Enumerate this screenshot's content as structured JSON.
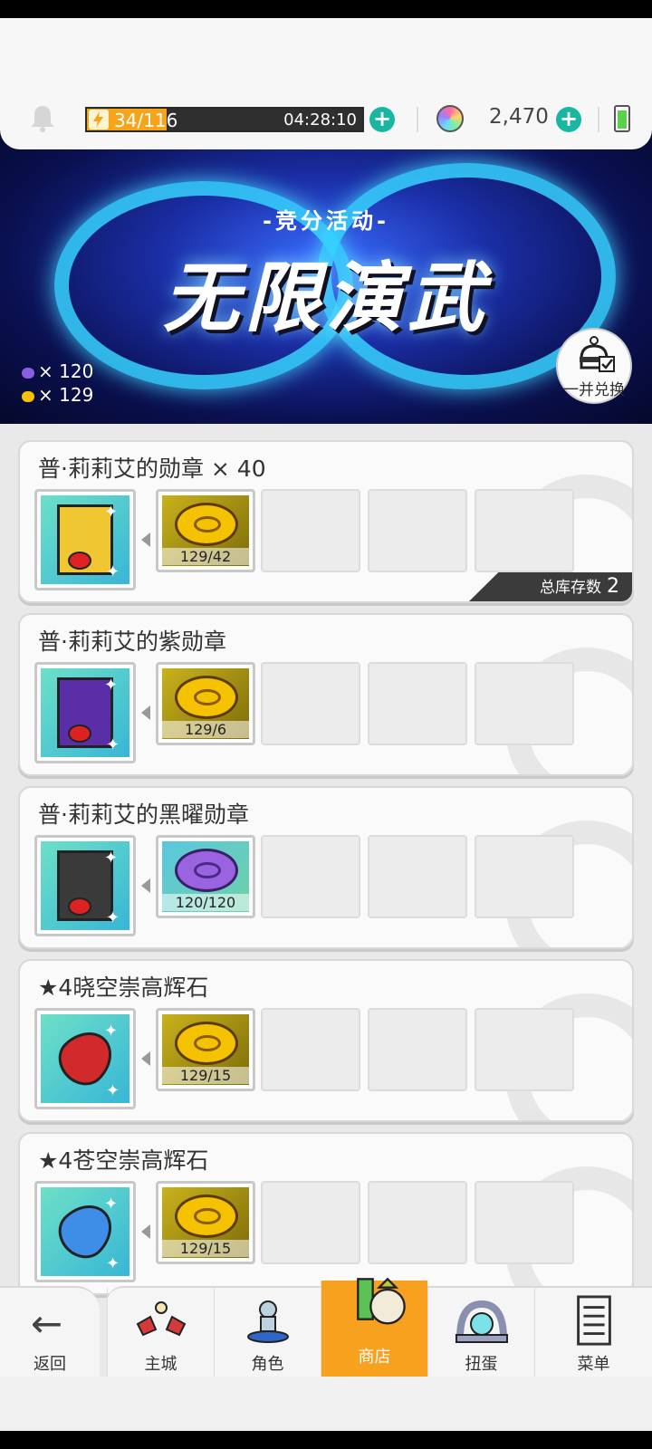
{
  "hud": {
    "stamina_value": "34/116",
    "stamina_fraction": 0.29,
    "stamina_timer": "04:28:10",
    "gem_count": "2,470",
    "accent_color": "#19b7a2"
  },
  "banner": {
    "subtitle": "-竞分活动-",
    "title": "无限演武",
    "tokens": [
      {
        "icon": "purple-token-icon",
        "count": "× 120"
      },
      {
        "icon": "gold-token-icon",
        "count": "× 129"
      }
    ],
    "exchange_label": "一并兑换"
  },
  "cards": [
    {
      "title": "普·莉莉艾的勋章 × 40",
      "reward_icon": "gold-badge-scroll-icon",
      "cost_icon": "gold-coin-icon",
      "cost": "129/42",
      "stock_label": "总库存数",
      "stock_value": "2"
    },
    {
      "title": "普·莉莉艾的紫勋章",
      "reward_icon": "purple-badge-scroll-icon",
      "cost_icon": "gold-coin-icon",
      "cost": "129/6"
    },
    {
      "title": "普·莉莉艾的黑曜勋章",
      "reward_icon": "black-badge-scroll-icon",
      "cost_icon": "purple-coin-icon",
      "cost": "120/120"
    },
    {
      "title": "★4晓空崇高辉石",
      "reward_icon": "red-crystal-icon",
      "cost_icon": "gold-coin-icon",
      "cost": "129/15"
    },
    {
      "title": "★4苍空崇高辉石",
      "reward_icon": "blue-crystal-icon",
      "cost_icon": "gold-coin-icon",
      "cost": "129/15"
    }
  ],
  "nav": {
    "back": "返回",
    "items": [
      {
        "label": "主城",
        "icon": "town-icon"
      },
      {
        "label": "角色",
        "icon": "character-icon"
      },
      {
        "label": "商店",
        "icon": "shop-icon",
        "active": true
      },
      {
        "label": "扭蛋",
        "icon": "gacha-icon"
      },
      {
        "label": "菜单",
        "icon": "menu-icon"
      }
    ]
  }
}
